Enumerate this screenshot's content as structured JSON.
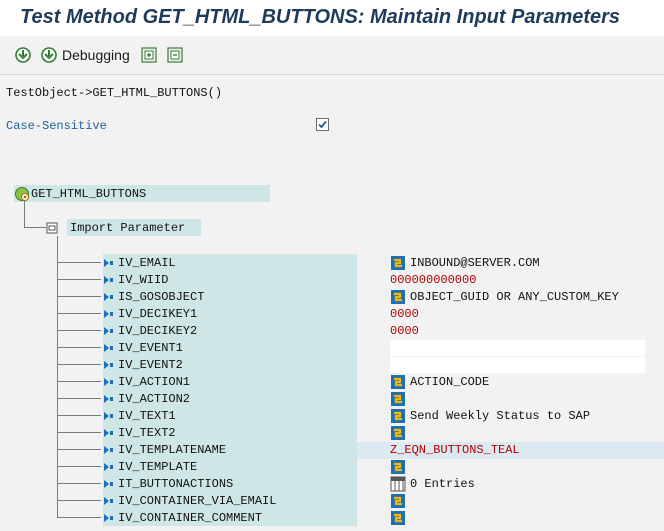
{
  "window": {
    "title": "Test Method GET_HTML_BUTTONS: Maintain Input Parameters"
  },
  "toolbar": {
    "debugging_label": "Debugging"
  },
  "object_path": "TestObject->GET_HTML_BUTTONS()",
  "case_sensitive": {
    "label": "Case-Sensitive",
    "checked": true
  },
  "tree": {
    "root": "GET_HTML_BUTTONS",
    "group": "Import Parameter",
    "params": [
      {
        "name": "IV_EMAIL",
        "value": "INBOUND@SERVER.COM",
        "icon": true,
        "red": false
      },
      {
        "name": "IV_WIID",
        "value": "000000000000",
        "icon": false,
        "red": true
      },
      {
        "name": "IS_GOSOBJECT",
        "value": "OBJECT_GUID OR ANY_CUSTOM_KEY",
        "icon": true,
        "red": false
      },
      {
        "name": "IV_DECIKEY1",
        "value": "0000",
        "icon": false,
        "red": true
      },
      {
        "name": "IV_DECIKEY2",
        "value": "0000",
        "icon": false,
        "red": true
      },
      {
        "name": "IV_EVENT1",
        "value": "",
        "icon": false,
        "red": false,
        "blank": true
      },
      {
        "name": "IV_EVENT2",
        "value": "",
        "icon": false,
        "red": false,
        "blank": true
      },
      {
        "name": "IV_ACTION1",
        "value": "ACTION_CODE",
        "icon": true,
        "red": false
      },
      {
        "name": "IV_ACTION2",
        "value": "",
        "icon": true,
        "red": false
      },
      {
        "name": "IV_TEXT1",
        "value": "Send Weekly Status to SAP",
        "icon": true,
        "red": false
      },
      {
        "name": "IV_TEXT2",
        "value": "",
        "icon": true,
        "red": false
      },
      {
        "name": "IV_TEMPLATENAME",
        "value": "Z_EQN_BUTTONS_TEAL",
        "icon": false,
        "red": true,
        "highlight": true
      },
      {
        "name": "IV_TEMPLATE",
        "value": "",
        "icon": true,
        "red": false
      },
      {
        "name": "IT_BUTTONACTIONS",
        "value": "0 Entries",
        "icon": "table",
        "red": false
      },
      {
        "name": "IV_CONTAINER_VIA_EMAIL",
        "value": "",
        "icon": true,
        "red": false
      },
      {
        "name": "IV_CONTAINER_COMMENT",
        "value": "",
        "icon": true,
        "red": false
      }
    ]
  }
}
